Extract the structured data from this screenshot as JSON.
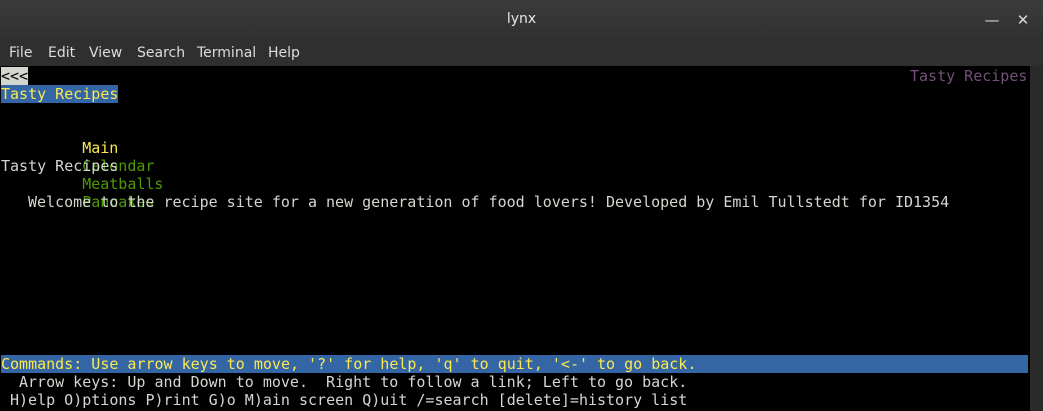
{
  "window": {
    "title": "lynx",
    "minimize_icon": "minimize-icon",
    "close_icon": "close-icon"
  },
  "menubar": {
    "items": [
      "File",
      "Edit",
      "View",
      "Search",
      "Terminal",
      "Help"
    ]
  },
  "lynx": {
    "back_link": "<<<",
    "top_right_title": "Tasty Recipes",
    "page_title": "Tasty Recipes",
    "nav": {
      "main": "Main",
      "calendar": "Calendar",
      "meatballs": "Meatballs",
      "pancakes": "Pancakes"
    },
    "heading": "Tasty Recipes",
    "welcome": "Welcome to the recipe site for a new generation of food lovers! Developed by Emil Tullstedt for ID1354",
    "status": "Commands: Use arrow keys to move, '?' for help, 'q' to quit, '<-' to go back.",
    "help_line_1": "Arrow keys: Up and Down to move.  Right to follow a link; Left to go back.",
    "help_line_2": "H)elp O)ptions P)rint G)o M)ain screen Q)uit /=search [delete]=history list"
  },
  "colors": {
    "terminal_background": "#000000",
    "text": "#d3d7cf",
    "status_background": "#3465a4",
    "status_text": "#fce94f",
    "link_green": "#4e9a06",
    "current_link_yellow": "#fce94f",
    "title_purple": "#75507b"
  }
}
